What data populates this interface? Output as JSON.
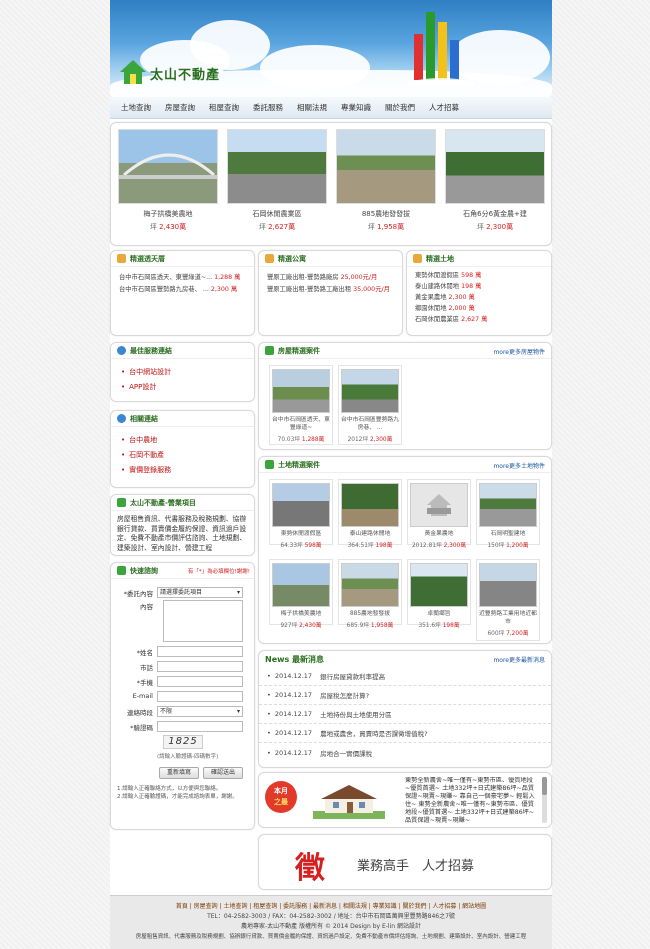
{
  "brand": {
    "name": "太山不動產"
  },
  "nav": [
    "土地查詢",
    "房屋查詢",
    "租屋查詢",
    "委託服務",
    "相關法規",
    "專業知識",
    "關於我們",
    "人才招募"
  ],
  "featured": [
    {
      "title": "梅子拱橋美農地",
      "price_label": "坪",
      "price": "2,430萬"
    },
    {
      "title": "石岡休閒農業區",
      "price_label": "坪",
      "price": "2,627萬"
    },
    {
      "title": "885農地發發拔",
      "price_label": "坪",
      "price": "1,958萬"
    },
    {
      "title": "石角6分6黃金農+建",
      "price_label": "坪",
      "price": "2,300萬"
    }
  ],
  "choice_villa": {
    "title": "精選透天厝",
    "items": [
      {
        "text": "台中市石岡區透天、東豐綠道~...",
        "price": "1,288 萬"
      },
      {
        "text": "台中市石岡區豐勢路九房巷、 ...",
        "price": "2,300 萬"
      }
    ]
  },
  "choice_apt": {
    "title": "精選公寓",
    "items": [
      {
        "text": "豐原工廠出租-豐勢路廠房",
        "price": "25,000元/月"
      },
      {
        "text": "豐原工廠出租-豐勢路工廠出租",
        "price": "35,000元/月"
      }
    ]
  },
  "choice_land": {
    "title": "精選土地",
    "items": [
      {
        "text": "東勢休閒渡假區",
        "price": "598 萬"
      },
      {
        "text": "泰山建路休閒地",
        "price": "198 萬"
      },
      {
        "text": "黃金果農地",
        "price": "2,300 萬"
      },
      {
        "text": "鄉園休閒地",
        "price": "2,000 萬"
      },
      {
        "text": "石岡休閒農業區",
        "price": "2,627 萬"
      }
    ]
  },
  "best_links": {
    "title": "最佳服務連結",
    "items": [
      "台中網站設計",
      "APP設計"
    ]
  },
  "related_links": {
    "title": "相關連結",
    "items": [
      "台中農地",
      "石岡不動產",
      "實價登錄服務"
    ]
  },
  "services": {
    "title": "太山不動產-營業項目",
    "text": "房屋租售資訊、代書服務及稅務規劃、協辦銀行貸款、買賣價金履約保證、資訊過戶設定、免費不動產市價評估諮詢、土地規劃、建築設計、室內設計、營建工程"
  },
  "quick_contact": {
    "title": "快速諮詢",
    "note": "有「*」為必填欄位!謝謝!",
    "fields": {
      "type_label": "*委託內容",
      "type_value": "請選擇委託項目",
      "content_label": "內容",
      "name_label": "*姓名",
      "phone_label": "市話",
      "mobile_label": "*手機",
      "email_label": "E-mail",
      "time_label": "連絡時段",
      "time_value": "不限",
      "code_label": "*驗證碼",
      "captcha": "1825",
      "captcha_hint": "(請輸入驗證碼-四碼數字)"
    },
    "reset": "重新填寫",
    "submit": "確認送出",
    "tips": [
      "1.請輸入正確聯絡方式，以方便與您聯絡。",
      "2.請輸入正確驗證碼，才能完成諮詢表單，謝謝。"
    ]
  },
  "house_cases": {
    "title": "房屋精選案件",
    "more": "more更多房屋物件",
    "items": [
      {
        "title": "台中市石岡區透天、東豐綠道~",
        "area": "70.03坪",
        "price": "1,288萬"
      },
      {
        "title": "台中市石岡區豐勢路九房巷、 ...",
        "area": "2012坪",
        "price": "2,300萬"
      }
    ]
  },
  "land_cases": {
    "title": "土地精選案件",
    "more": "more更多土地物件",
    "items": [
      {
        "title": "東勢休閒渡假區",
        "area": "64.33坪",
        "price": "598萬"
      },
      {
        "title": "泰山建路休閒地",
        "area": "364.51坪",
        "price": "198萬"
      },
      {
        "title": "黃金果農地",
        "area": "2012.81坪",
        "price": "2,300萬"
      },
      {
        "title": "石岡明聖建地",
        "area": "150坪",
        "price": "1,200萬"
      },
      {
        "title": "梅子拱橋美農地",
        "area": "927坪",
        "price": "2,430萬"
      },
      {
        "title": "885農地發發拔",
        "area": "685.9坪",
        "price": "1,958萬"
      },
      {
        "title": "卓蘭鄉旨",
        "area": "351.6坪",
        "price": "198萬"
      },
      {
        "title": "近豐勢路工業用地近都市",
        "area": "600坪",
        "price": "7,200萬"
      }
    ]
  },
  "news": {
    "title": "News 最新消息",
    "more": "more更多最新消息",
    "items": [
      {
        "date": "2014.12.17",
        "text": "銀行房屋貸款利率提高"
      },
      {
        "date": "2014.12.17",
        "text": "房屋稅怎麼計算?"
      },
      {
        "date": "2014.12.17",
        "text": "土地持份與土地使用分區"
      },
      {
        "date": "2014.12.17",
        "text": "農地或農舍，買賣時是否課徵增值稅?"
      },
      {
        "date": "2014.12.17",
        "text": "房地合一實價課稅"
      }
    ]
  },
  "monthly": {
    "badge_line1": "本月",
    "badge_line2": "之最",
    "text": "東勢全新農舍~唯一僅有~東勢市區、優質地段~優質首選~ 土地332坪+日式建築86坪~品質保證~現賣~現賺~ 靠自己一個豪宅夢~ 輕鬆入住~ 東勢全新農舍~唯一僅有~東勢市區、優質地段~優質首選~ 土地332坪+日式建築86坪~品質保證~現賣~現賺~"
  },
  "recruit": {
    "big_char": "徵",
    "text": "業務高手　人才招募"
  },
  "footer": {
    "links": "首頁 | 房屋查詢 | 土地查詢 | 租屋查詢 | 委託服務 | 最新消息 | 相關法規 | 專業知識 | 關於我們 | 人才招募 | 網站地圖",
    "contact": "TEL：04-2582-3003 / FAX：04-2582-3002 / 地址：台中市石岡區萬興里豐勢路846之7號",
    "copyright": "農地專家-太山不動產 版權所有 © 2014 Design by E-lin 網站設計",
    "services": "房屋租售資訊、代書服務及稅務規劃、協辦銀行貸款、買賣價金履約保證、資訊過戶設定、免費不動產市價評估諮詢、土地規劃、建築設計、室內設計、營建工程"
  },
  "colors": {
    "accent_green": "#2a6e1f",
    "price_red": "#d42020",
    "link_blue": "#1a55a0"
  }
}
